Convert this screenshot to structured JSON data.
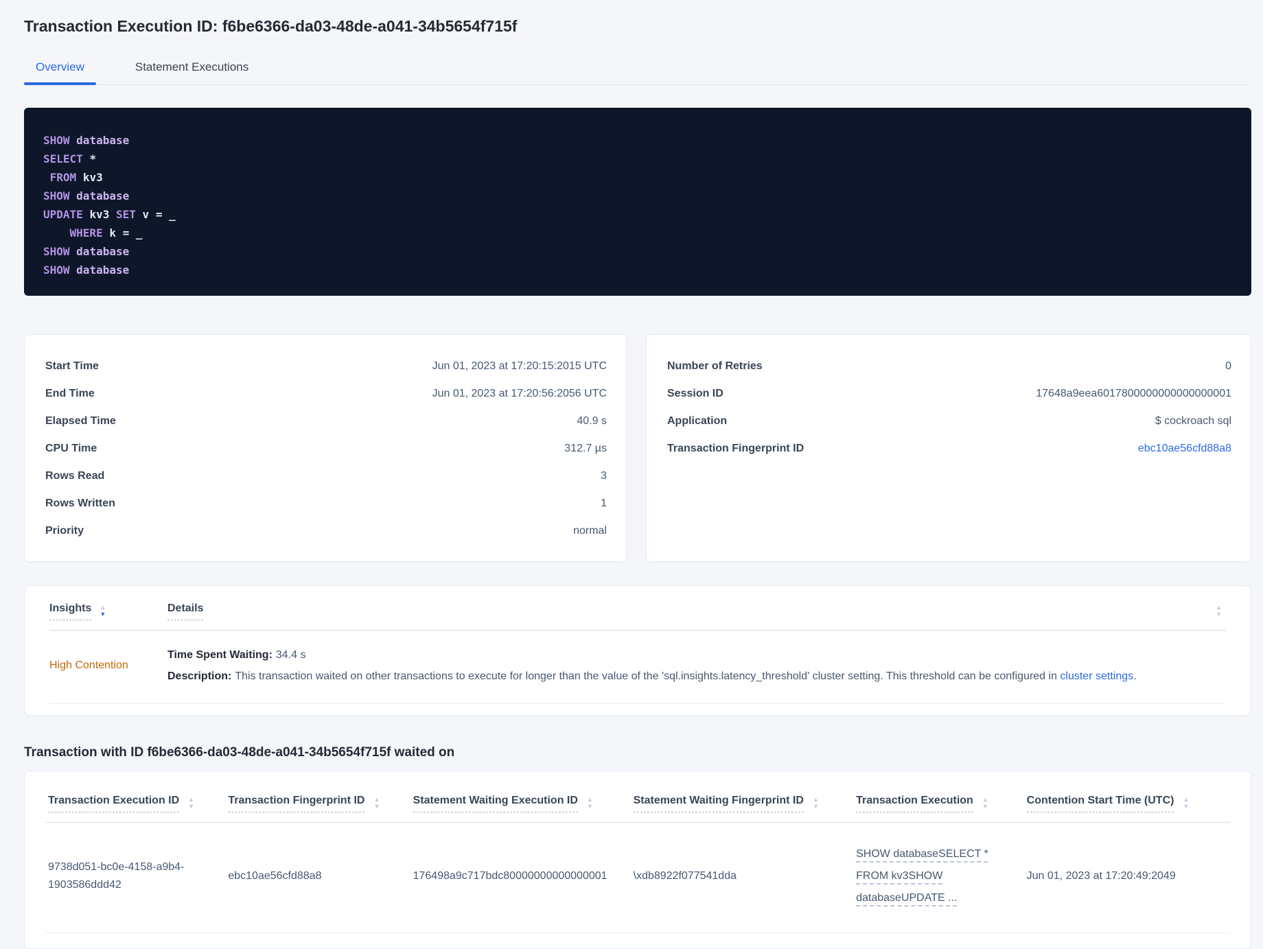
{
  "header": {
    "title": "Transaction Execution ID: f6be6366-da03-48de-a041-34b5654f715f",
    "tabs": [
      {
        "label": "Overview",
        "active": true
      },
      {
        "label": "Statement Executions",
        "active": false
      }
    ]
  },
  "sql_box": {
    "lines": [
      {
        "indent": 0,
        "tokens": [
          {
            "text": "SHOW",
            "type": "kw"
          },
          {
            "text": "database",
            "type": "name"
          }
        ]
      },
      {
        "indent": 0,
        "tokens": [
          {
            "text": "SELECT",
            "type": "kw"
          },
          {
            "text": "*",
            "type": "id"
          }
        ]
      },
      {
        "indent": 1,
        "tokens": [
          {
            "text": "FROM",
            "type": "kw"
          },
          {
            "text": "kv3",
            "type": "id"
          }
        ]
      },
      {
        "indent": 0,
        "tokens": [
          {
            "text": "SHOW",
            "type": "kw"
          },
          {
            "text": "database",
            "type": "name"
          }
        ]
      },
      {
        "indent": 0,
        "tokens": [
          {
            "text": "UPDATE",
            "type": "kw"
          },
          {
            "text": "kv3",
            "type": "id"
          },
          {
            "text": "SET",
            "type": "kw"
          },
          {
            "text": "v",
            "type": "id"
          },
          {
            "text": "=",
            "type": "id"
          },
          {
            "text": "_",
            "type": "id"
          }
        ]
      },
      {
        "indent": 4,
        "tokens": [
          {
            "text": "WHERE",
            "type": "kw"
          },
          {
            "text": "k",
            "type": "id"
          },
          {
            "text": "=",
            "type": "id"
          },
          {
            "text": "_",
            "type": "id"
          }
        ]
      },
      {
        "indent": 0,
        "tokens": [
          {
            "text": "SHOW",
            "type": "kw"
          },
          {
            "text": "database",
            "type": "name"
          }
        ]
      },
      {
        "indent": 0,
        "tokens": [
          {
            "text": "SHOW",
            "type": "kw"
          },
          {
            "text": "database",
            "type": "name"
          }
        ]
      }
    ]
  },
  "summary": {
    "left_rows": [
      {
        "label": "Start Time",
        "value": "Jun 01, 2023 at 17:20:15:2015 UTC"
      },
      {
        "label": "End Time",
        "value": "Jun 01, 2023 at 17:20:56:2056 UTC"
      },
      {
        "label": "Elapsed Time",
        "value": "40.9 s"
      },
      {
        "label": "CPU Time",
        "value": "312.7 µs"
      },
      {
        "label": "Rows Read",
        "value": "3"
      },
      {
        "label": "Rows Written",
        "value": "1"
      },
      {
        "label": "Priority",
        "value": "normal"
      }
    ],
    "right_rows": [
      {
        "label": "Number of Retries",
        "value": "0"
      },
      {
        "label": "Session ID",
        "value": "17648a9eea6017800000000000000001"
      },
      {
        "label": "Application",
        "value": "$ cockroach sql"
      },
      {
        "label": "Transaction Fingerprint ID",
        "value": "ebc10ae56cfd88a8",
        "link": true
      }
    ]
  },
  "insights": {
    "columns": [
      {
        "label": "Insights",
        "sorted": "desc"
      },
      {
        "label": "Details",
        "sorted": null
      }
    ],
    "rows": [
      {
        "insight": "High Contention",
        "waiting_label": "Time Spent Waiting:",
        "waiting_value": "34.4 s",
        "description_label": "Description:",
        "description_text": "This transaction waited on other transactions to execute for longer than the value of the 'sql.insights.latency_threshold' cluster setting. This threshold can be configured in ",
        "description_link": "cluster settings",
        "description_suffix": "."
      }
    ]
  },
  "waited_on": {
    "heading": "Transaction with ID f6be6366-da03-48de-a041-34b5654f715f waited on",
    "columns": [
      "Transaction Execution ID",
      "Transaction Fingerprint ID",
      "Statement Waiting Execution ID",
      "Statement Waiting Fingerprint ID",
      "Transaction Execution",
      "Contention Start Time (UTC)"
    ],
    "rows": [
      {
        "transaction_execution_id": "9738d051-bc0e-4158-a9b4-1903586ddd42",
        "transaction_fingerprint_id": "ebc10ae56cfd88a8",
        "statement_waiting_execution_id": "176498a9c717bdc80000000000000001",
        "statement_waiting_fingerprint_id": "\\xdb8922f077541dda",
        "transaction_execution": "SHOW databaseSELECT * FROM kv3SHOW databaseUPDATE ...",
        "contention_start_time": "Jun 01, 2023 at 17:20:49:2049"
      }
    ]
  },
  "colors": {
    "accent_blue": "#2b6be4",
    "warning_orange": "#c26809",
    "code_background": "#0e1729",
    "code_keyword": "#b292e3",
    "code_name": "#cdb4f0",
    "page_background": "#f4f6fa"
  }
}
